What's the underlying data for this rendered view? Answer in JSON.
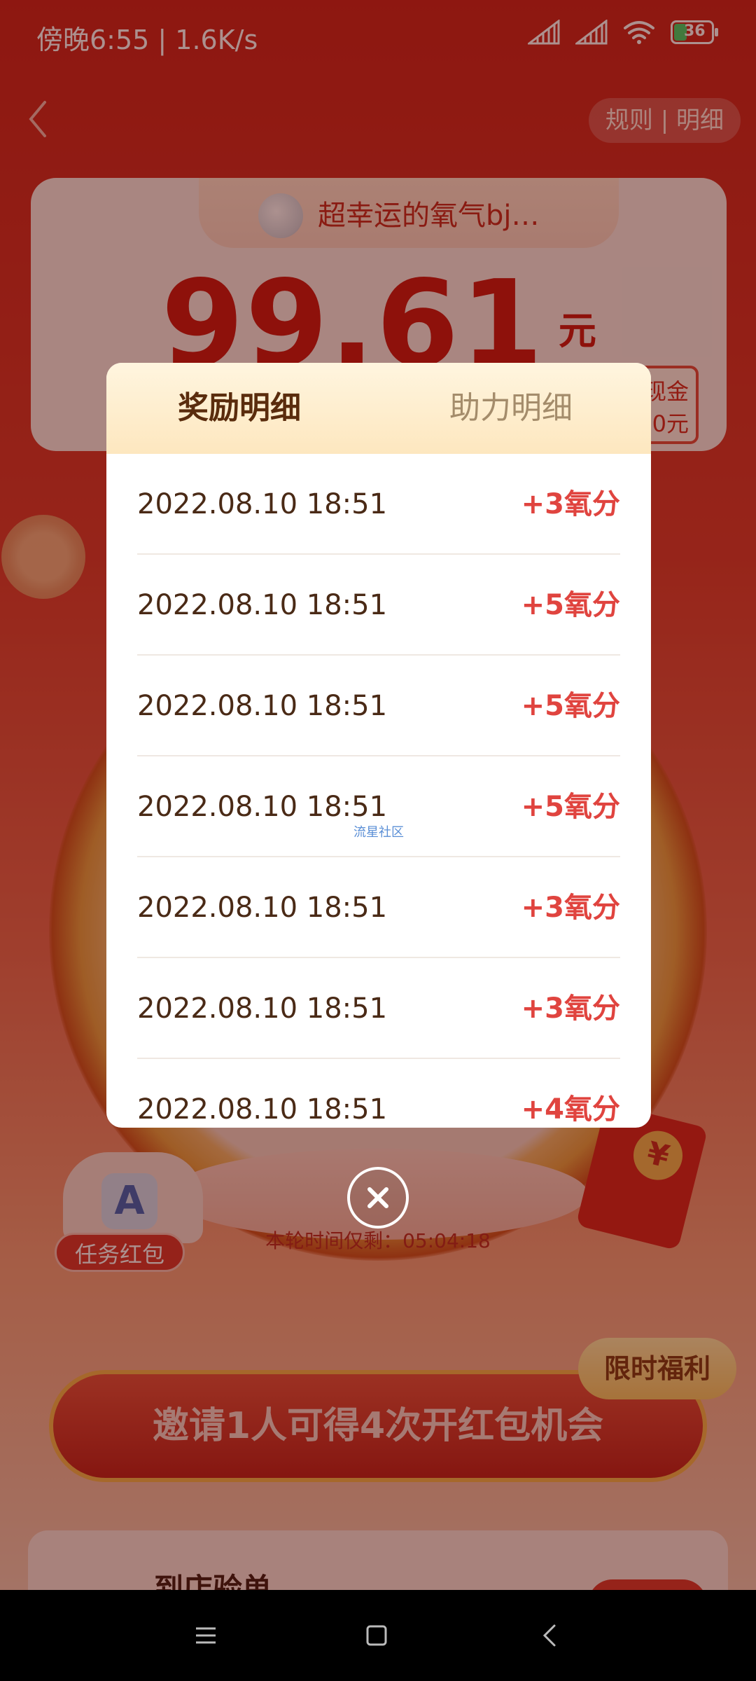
{
  "status_bar": {
    "time": "傍晚6:55 | 1.6K/s",
    "battery": "36"
  },
  "header": {
    "rules_label": "规则 | 明细"
  },
  "user": {
    "name": "超幸运的氧气bj…"
  },
  "balance": {
    "amount": "99.61",
    "unit": "元"
  },
  "card_side": {
    "line1": "现金",
    "line2": "0元"
  },
  "task": {
    "label": "任务红包"
  },
  "timer": {
    "text": "本轮时间仅剩：05:04:18"
  },
  "promo": {
    "badge": "限时福利",
    "invite": "邀请1人可得4次开红包机会"
  },
  "bottom_card": {
    "title": "到店验单"
  },
  "modal": {
    "tab_active": "奖励明细",
    "tab_inactive": "助力明细",
    "watermark": "流星社区",
    "rows": [
      {
        "time": "2022.08.10 18:51",
        "points": "+3氧分"
      },
      {
        "time": "2022.08.10 18:51",
        "points": "+5氧分"
      },
      {
        "time": "2022.08.10 18:51",
        "points": "+5氧分"
      },
      {
        "time": "2022.08.10 18:51",
        "points": "+5氧分"
      },
      {
        "time": "2022.08.10 18:51",
        "points": "+3氧分"
      },
      {
        "time": "2022.08.10 18:51",
        "points": "+3氧分"
      },
      {
        "time": "2022.08.10 18:51",
        "points": "+4氧分"
      }
    ]
  },
  "colors": {
    "accent_red": "#e0443f",
    "brand_red": "#c8221a",
    "tab_active": "#5a2c0d"
  },
  "icons": [
    "back-arrow-icon",
    "signal-icon",
    "wifi-icon",
    "battery-icon",
    "close-icon",
    "menu-icon",
    "home-icon",
    "back-icon"
  ]
}
